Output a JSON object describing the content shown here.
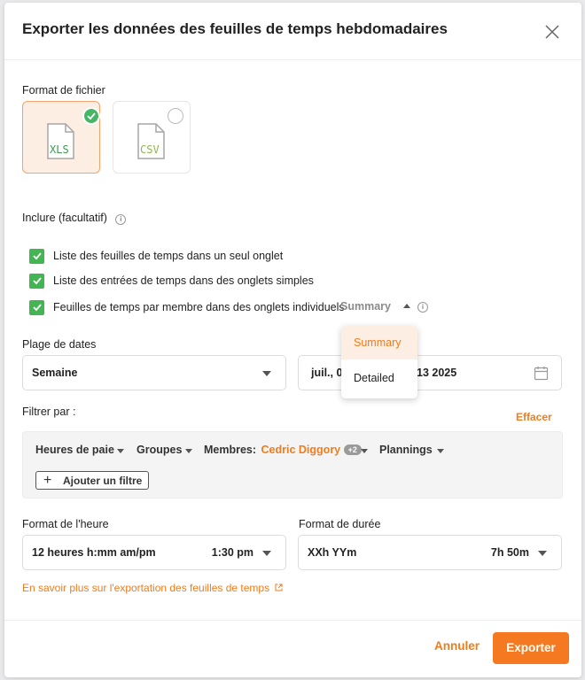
{
  "dialog": {
    "title": "Exporter les données des feuilles de temps hebdomadaires"
  },
  "file_format": {
    "label": "Format de fichier",
    "options": [
      {
        "name": "XLS",
        "selected": true
      },
      {
        "name": "CSV",
        "selected": false
      }
    ]
  },
  "include": {
    "label": "Inclure (facultatif)",
    "items": [
      {
        "label": "Liste des feuilles de temps dans un seul onglet",
        "checked": true
      },
      {
        "label": "Liste des entrées de temps dans des onglets simples",
        "checked": true
      },
      {
        "label": "Feuilles de temps par membre dans des onglets individuels",
        "checked": true
      }
    ],
    "detail_select": {
      "value": "Summary",
      "options": [
        "Summary",
        "Detailed"
      ]
    }
  },
  "date_range": {
    "label": "Plage de dates",
    "period": "Semaine",
    "range_prefix": "juil., 0",
    "range_suffix": "13 2025"
  },
  "filter": {
    "label": "Filtrer par :",
    "clear": "Effacer",
    "items": {
      "pay_hours": "Heures de paie",
      "groups": "Groupes",
      "members": "Membres:",
      "member_value": "Cedric Diggory",
      "member_badge": "+2",
      "schedules": "Plannings"
    },
    "add": "Ajouter un filtre"
  },
  "time_format": {
    "label": "Format de l'heure",
    "value": "12 heures h:mm am/pm",
    "example": "1:30 pm"
  },
  "duration_format": {
    "label": "Format de durée",
    "value": "XXh YYm",
    "example": "7h 50m"
  },
  "learn_more": "En savoir plus sur l'exportation des feuilles de temps",
  "footer": {
    "cancel": "Annuler",
    "export": "Exporter"
  },
  "colors": {
    "accent": "#f47920",
    "check": "#43b552"
  }
}
